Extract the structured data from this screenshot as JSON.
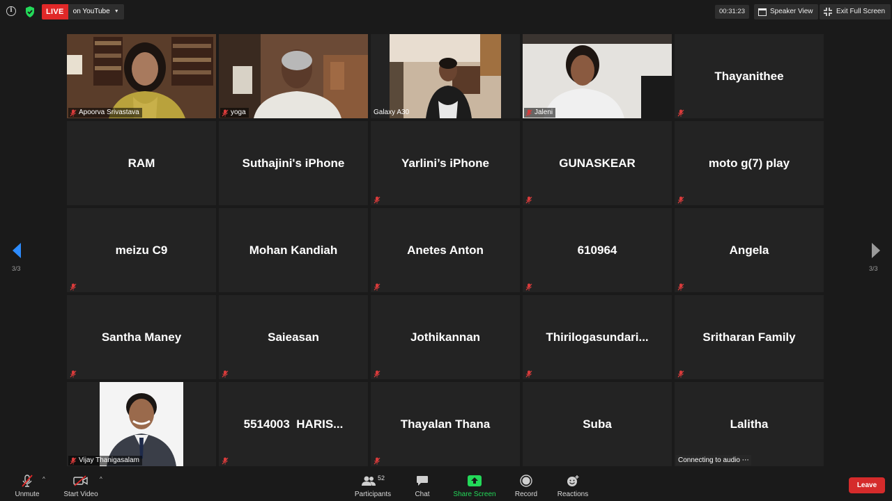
{
  "topbar": {
    "live_badge": "LIVE",
    "live_destination": "on YouTube",
    "timer": "00:31:23",
    "speaker_view_label": "Speaker View",
    "exit_fullscreen_label": "Exit Full Screen"
  },
  "participants": [
    {
      "name": "Apoorva Srivastava",
      "video": true,
      "muted": true
    },
    {
      "name": "yoga",
      "video": true,
      "muted": true
    },
    {
      "name": "Galaxy A30",
      "video": true,
      "muted": false
    },
    {
      "name": "Jaleni",
      "video": true,
      "muted": true
    },
    {
      "name": "Thayanithee",
      "video": false,
      "muted": true
    },
    {
      "name": "RAM",
      "video": false,
      "muted": false
    },
    {
      "name": "Suthajini's iPhone",
      "video": false,
      "muted": false
    },
    {
      "name": "Yarlini’s iPhone",
      "video": false,
      "muted": true
    },
    {
      "name": "GUNASKEAR",
      "video": false,
      "muted": true
    },
    {
      "name": "moto g(7) play",
      "video": false,
      "muted": true
    },
    {
      "name": "meizu C9",
      "video": false,
      "muted": true
    },
    {
      "name": "Mohan Kandiah",
      "video": false,
      "muted": false
    },
    {
      "name": "Anetes Anton",
      "video": false,
      "muted": true
    },
    {
      "name": "610964",
      "video": false,
      "muted": true
    },
    {
      "name": "Angela",
      "video": false,
      "muted": true
    },
    {
      "name": "Santha Maney",
      "video": false,
      "muted": true
    },
    {
      "name": "Saieasan",
      "video": false,
      "muted": true
    },
    {
      "name": "Jothikannan",
      "video": false,
      "muted": true
    },
    {
      "name": "Thirilogasundari...",
      "video": false,
      "muted": true
    },
    {
      "name": "Sritharan Family",
      "video": false,
      "muted": true
    },
    {
      "name": "Vijay Thanigasalam",
      "video": true,
      "muted": true
    },
    {
      "name": "5514003  HARIS...",
      "video": false,
      "muted": true
    },
    {
      "name": "Thayalan Thana",
      "video": false,
      "muted": true
    },
    {
      "name": "Suba",
      "video": false,
      "muted": false
    },
    {
      "name": "Lalitha",
      "video": false,
      "muted": false,
      "status": "Connecting to audio"
    }
  ],
  "pagination": {
    "left": "3/3",
    "right": "3/3"
  },
  "toolbar": {
    "unmute_label": "Unmute",
    "start_video_label": "Start Video",
    "participants_label": "Participants",
    "participants_count": "52",
    "chat_label": "Chat",
    "share_screen_label": "Share Screen",
    "record_label": "Record",
    "reactions_label": "Reactions",
    "leave_label": "Leave"
  },
  "colors": {
    "live_red": "#e02828",
    "share_green": "#23d959",
    "leave_red": "#d52b2b",
    "nav_blue": "#2d8cff",
    "tile_bg": "#232323"
  }
}
